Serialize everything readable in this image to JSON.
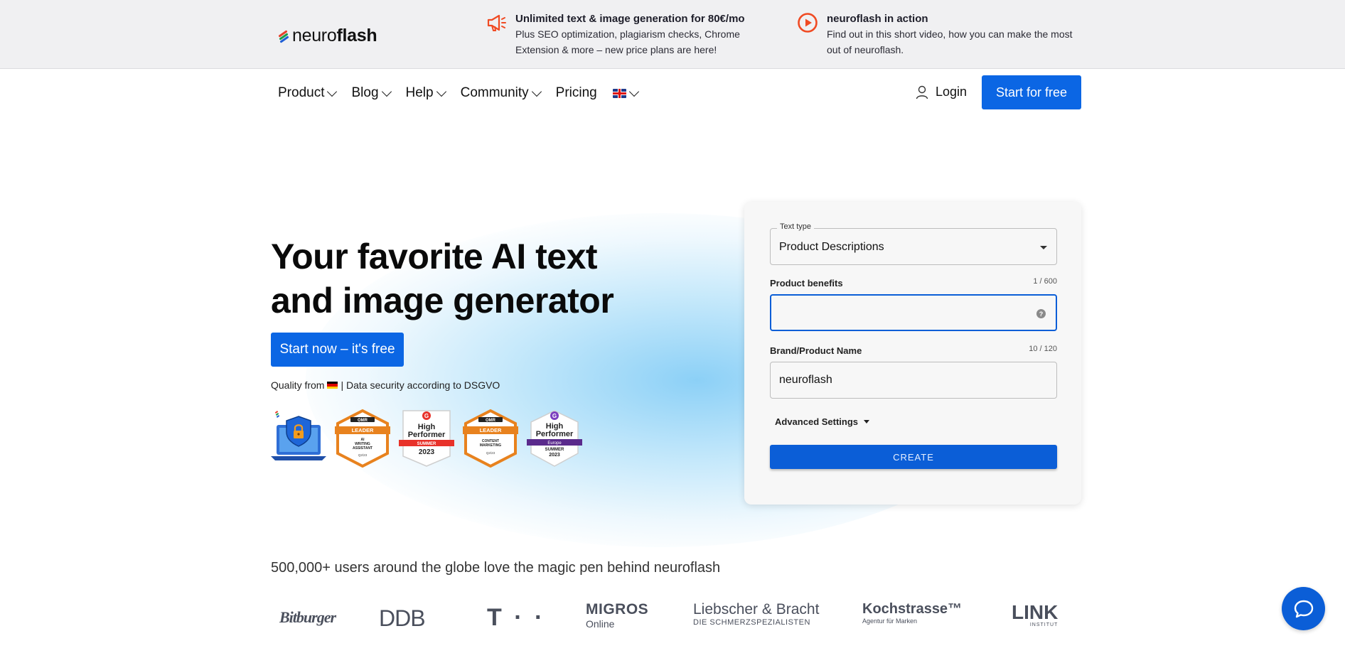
{
  "brand": {
    "name_regular": "neuro",
    "name_bold": "flash"
  },
  "topbar": {
    "promo1": {
      "title": "Unlimited text & image generation for 80€/mo",
      "desc": "Plus SEO optimization, plagiarism checks, Chrome Extension & more – new price plans are here!",
      "icon": "megaphone-icon"
    },
    "promo2": {
      "title": "neuroflash in action",
      "desc": "Find out in this short video, how you can make the most out of neuroflash.",
      "icon": "play-circle-icon"
    }
  },
  "nav": {
    "items": [
      {
        "label": "Product"
      },
      {
        "label": "Blog"
      },
      {
        "label": "Help"
      },
      {
        "label": "Community"
      },
      {
        "label": "Pricing"
      }
    ],
    "language_icon": "uk-flag-icon",
    "login": "Login",
    "start_free": "Start for free"
  },
  "hero": {
    "title_line1": "Your favorite AI text",
    "title_line2": "and image generator",
    "cta": "Start now – it's free",
    "quality_prefix": "Quality from",
    "quality_suffix": "| Data security according to DSGVO",
    "badges": [
      {
        "icon": "data-security-laptop-icon"
      },
      {
        "icon": "omr-leader-badge",
        "top": "OMR",
        "band": "LEADER",
        "line1": "AI",
        "line2": "WRITING",
        "line3": "ASSISTANT",
        "date": "Q2/23"
      },
      {
        "icon": "g2-high-performer-badge",
        "line1": "High",
        "line2": "Performer",
        "band": "SUMMER",
        "year": "2023"
      },
      {
        "icon": "omr-leader-badge",
        "top": "OMR",
        "band": "LEADER",
        "line1": "CONTENT",
        "line2": "MARKETING",
        "date": "Q2/23"
      },
      {
        "icon": "g2-high-performer-europe-badge",
        "line1": "High",
        "line2": "Performer",
        "band": "Europe",
        "season": "SUMMER",
        "year": "2023"
      }
    ]
  },
  "generator": {
    "text_type_label": "Text type",
    "text_type_value": "Product Descriptions",
    "benefits_label": "Product benefits",
    "benefits_counter": "1 / 600",
    "benefits_value": "",
    "brand_label": "Brand/Product Name",
    "brand_counter": "10 / 120",
    "brand_value": "neuroflash",
    "advanced": "Advanced Settings",
    "create": "CREATE"
  },
  "social": {
    "users_line": "500,000+ users around the globe love the magic pen behind neuroflash",
    "brands": [
      {
        "name": "Bitburger"
      },
      {
        "name": "DDB"
      },
      {
        "name": "T · ·"
      },
      {
        "name": "MIGROS",
        "sub": "Online"
      },
      {
        "name": "Liebscher & Bracht",
        "sub": "DIE SCHMERZSPEZIALISTEN"
      },
      {
        "name": "Kochstrasse™",
        "sub": "Agentur für Marken"
      },
      {
        "name": "LINK",
        "sub": "INSTITUT"
      }
    ]
  },
  "colors": {
    "primary": "#0b66e4",
    "accent": "#f04a23",
    "g2_red": "#e8322a",
    "omr_orange": "#e8821e"
  }
}
